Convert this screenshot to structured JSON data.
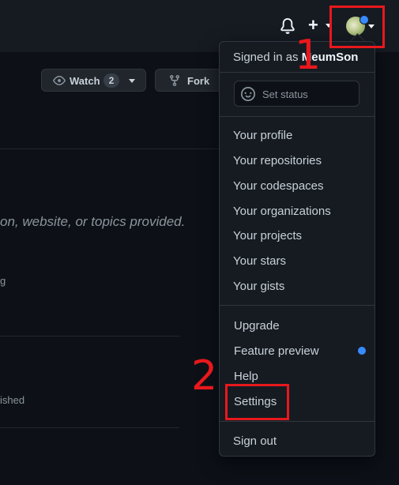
{
  "header": {
    "notifications_icon": "bell-icon",
    "create_icon": "plus-icon",
    "create_symbol": "+",
    "avatar_icon": "avatar-image",
    "annotation_1": "1",
    "annotation_2": "2"
  },
  "repo_actions": {
    "watch_label": "Watch",
    "watch_count": "2",
    "fork_label": "Fork"
  },
  "background": {
    "description": "on, website, or topics provided.",
    "fragment1": "g",
    "fragment2": "ished"
  },
  "menu": {
    "signed_in_prefix": "Signed in as",
    "username": "MeumSon",
    "set_status": "Set status",
    "items1": [
      "Your profile",
      "Your repositories",
      "Your codespaces",
      "Your organizations",
      "Your projects",
      "Your stars",
      "Your gists"
    ],
    "items2": [
      "Upgrade",
      "Feature preview",
      "Help",
      "Settings"
    ],
    "sign_out": "Sign out"
  },
  "colors": {
    "background": "#0d1117",
    "header": "#161b22",
    "annotation_red": "#e8181c",
    "accent_blue": "#388bfd"
  }
}
